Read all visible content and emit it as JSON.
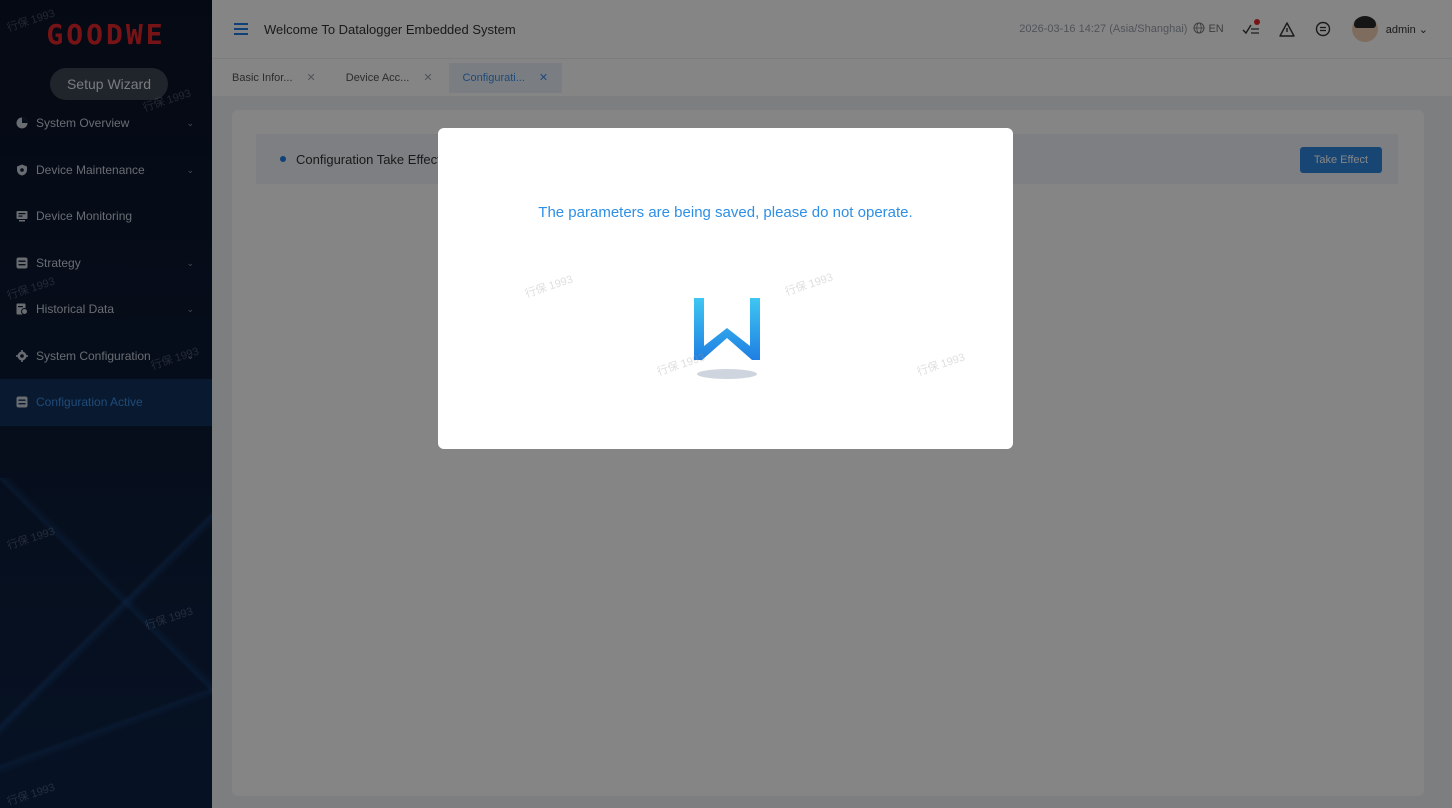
{
  "brand": {
    "logo_text": "GOODWE",
    "logo_color": "#e3262c"
  },
  "sidebar": {
    "wizard_label": "Setup Wizard",
    "items": [
      {
        "label": "System Overview",
        "icon": "pie-chart-icon",
        "has_submenu": true
      },
      {
        "label": "Device Maintenance",
        "icon": "shield-icon",
        "has_submenu": true
      },
      {
        "label": "Device Monitoring",
        "icon": "monitor-icon",
        "has_submenu": false
      },
      {
        "label": "Strategy",
        "icon": "strategy-icon",
        "has_submenu": true
      },
      {
        "label": "Historical Data",
        "icon": "history-icon",
        "has_submenu": true
      },
      {
        "label": "System Configuration",
        "icon": "settings-icon",
        "has_submenu": true
      },
      {
        "label": "Configuration Active",
        "icon": "config-icon",
        "has_submenu": false,
        "active": true
      }
    ]
  },
  "header": {
    "title": "Welcome To Datalogger Embedded System",
    "datetime": "2026-03-16 14:27 (Asia/Shanghai)",
    "language": "EN",
    "user": "admin"
  },
  "tabs": [
    {
      "label": "Basic Infor...",
      "active": false
    },
    {
      "label": "Device Acc...",
      "active": false
    },
    {
      "label": "Configurati...",
      "active": true
    }
  ],
  "content": {
    "section_title": "Configuration Take Effect",
    "take_effect_button": "Take Effect"
  },
  "modal": {
    "message": "The parameters are being saved, please do not operate."
  },
  "watermark": "行保 1993",
  "colors": {
    "accent": "#1e7ee6",
    "sidebar_bg": "#0c1a33",
    "active_text": "#3a8fe8"
  }
}
